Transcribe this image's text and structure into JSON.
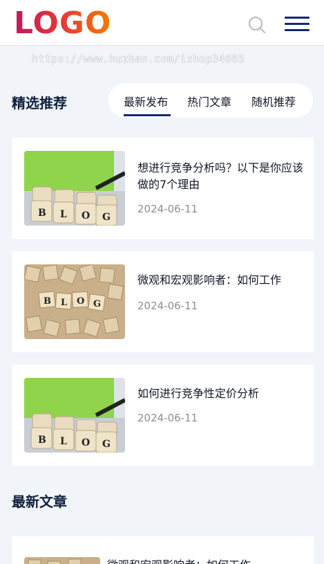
{
  "header": {
    "logo": "LOGO"
  },
  "watermark": "https://www.huzhan.com/ishop34665",
  "featured": {
    "title": "精选推荐",
    "tabs": [
      "最新发布",
      "热门文章",
      "随机推荐"
    ],
    "active_tab": 0
  },
  "articles": [
    {
      "title": "想进行竞争分析吗？以下是你应该做的7个理由",
      "date": "2024-06-11"
    },
    {
      "title": "微观和宏观影响者：如何工作",
      "date": "2024-06-11"
    },
    {
      "title": "如何进行竞争性定价分析",
      "date": "2024-06-11"
    }
  ],
  "latest": {
    "title": "最新文章",
    "items": [
      {
        "title": "微观和宏观影响者：如何工作"
      }
    ]
  },
  "colors": {
    "accent": "#0f2a75",
    "background": "#f1f5f9",
    "date": "#8a8f98"
  }
}
